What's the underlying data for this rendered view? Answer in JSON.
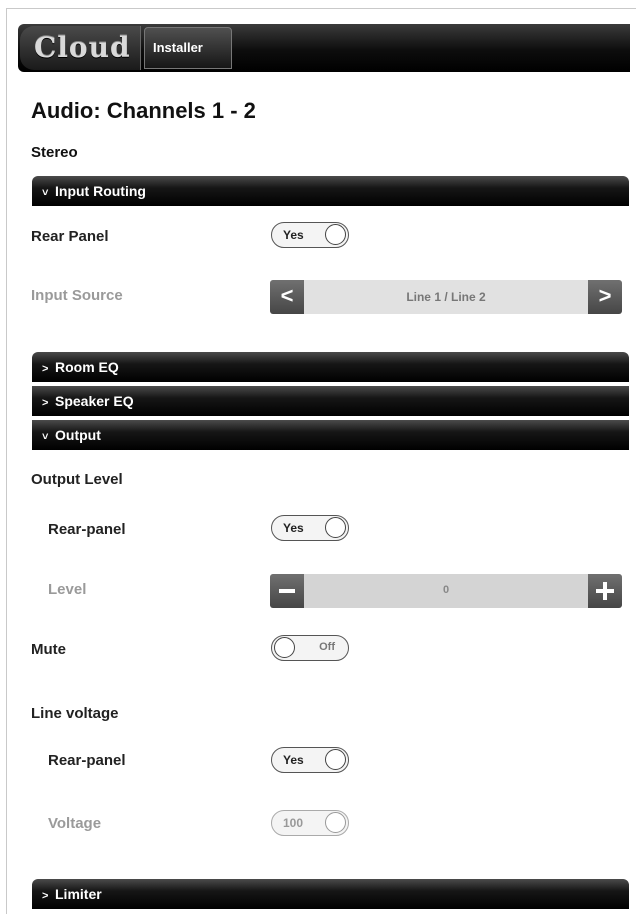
{
  "header": {
    "logo": "Cloud",
    "installer_tab": "Installer"
  },
  "page": {
    "title": "Audio: Channels 1 - 2",
    "subtitle": "Stereo"
  },
  "icons": {
    "chevron_down": "˅",
    "chevron_right": ">",
    "arrow_left": "<",
    "arrow_right": ">"
  },
  "sections": {
    "input_routing": "Input Routing",
    "room_eq": "Room EQ",
    "speaker_eq": "Speaker EQ",
    "output": "Output",
    "limiter": "Limiter"
  },
  "input_routing": {
    "rear_panel_label": "Rear Panel",
    "rear_panel_value": "Yes",
    "input_source_label": "Input Source",
    "input_source_value": "Line 1 / Line 2"
  },
  "output": {
    "output_level_heading": "Output Level",
    "rear_panel_label": "Rear-panel",
    "rear_panel_value": "Yes",
    "level_label": "Level",
    "level_value": "0",
    "mute_label": "Mute",
    "mute_value": "Off",
    "line_voltage_heading": "Line voltage",
    "lv_rear_panel_label": "Rear-panel",
    "lv_rear_panel_value": "Yes",
    "voltage_label": "Voltage",
    "voltage_value": "100"
  },
  "colors": {
    "bar_dark": "#000000",
    "disabled_text": "#9a9a9a",
    "control_gray": "#e1e1e1"
  }
}
